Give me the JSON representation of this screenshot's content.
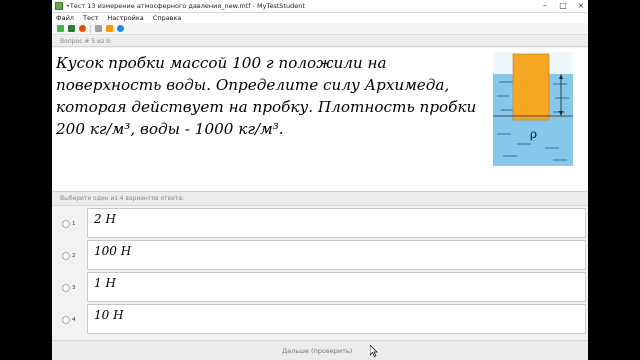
{
  "window": {
    "title": "•Тест 13 измерение атмосферного давления_new.mtf - MyTestStudent",
    "controls": {
      "minimize": "–",
      "maximize": "□",
      "close": "×"
    }
  },
  "menu": {
    "items": [
      "Файл",
      "Тест",
      "Настройка",
      "Справка"
    ]
  },
  "toolbar": {
    "icons": [
      "open-icon",
      "play-icon",
      "stop-icon",
      "settings-icon",
      "restart-icon",
      "help-icon"
    ],
    "colors": [
      "#4caf50",
      "#2e7d32",
      "#e65100",
      "#9e9e9e",
      "#ff9800",
      "#1e88e5"
    ]
  },
  "question": {
    "number_label": "Вопрос # 5 из 9:",
    "lines": [
      "Кусок пробки массой 100 г положили на",
      "поверхность воды. Определите силу Архимеда,",
      "которая действует на пробку. Плотность пробки",
      "200 кг/м³, воды - 1000 кг/м³."
    ],
    "image_label": "ρ"
  },
  "answers": {
    "instruction": "Выберите один из 4 вариантов ответа:",
    "options": [
      {
        "num": "1",
        "text": "2 Н"
      },
      {
        "num": "2",
        "text": "100 Н"
      },
      {
        "num": "3",
        "text": "1 Н"
      },
      {
        "num": "4",
        "text": "10 Н"
      }
    ]
  },
  "footer": {
    "next_label": "Дальше (проверить)"
  },
  "colors": {
    "water": "#87c8ea",
    "cork": "#f5a623",
    "accent": "#6aa84f"
  }
}
